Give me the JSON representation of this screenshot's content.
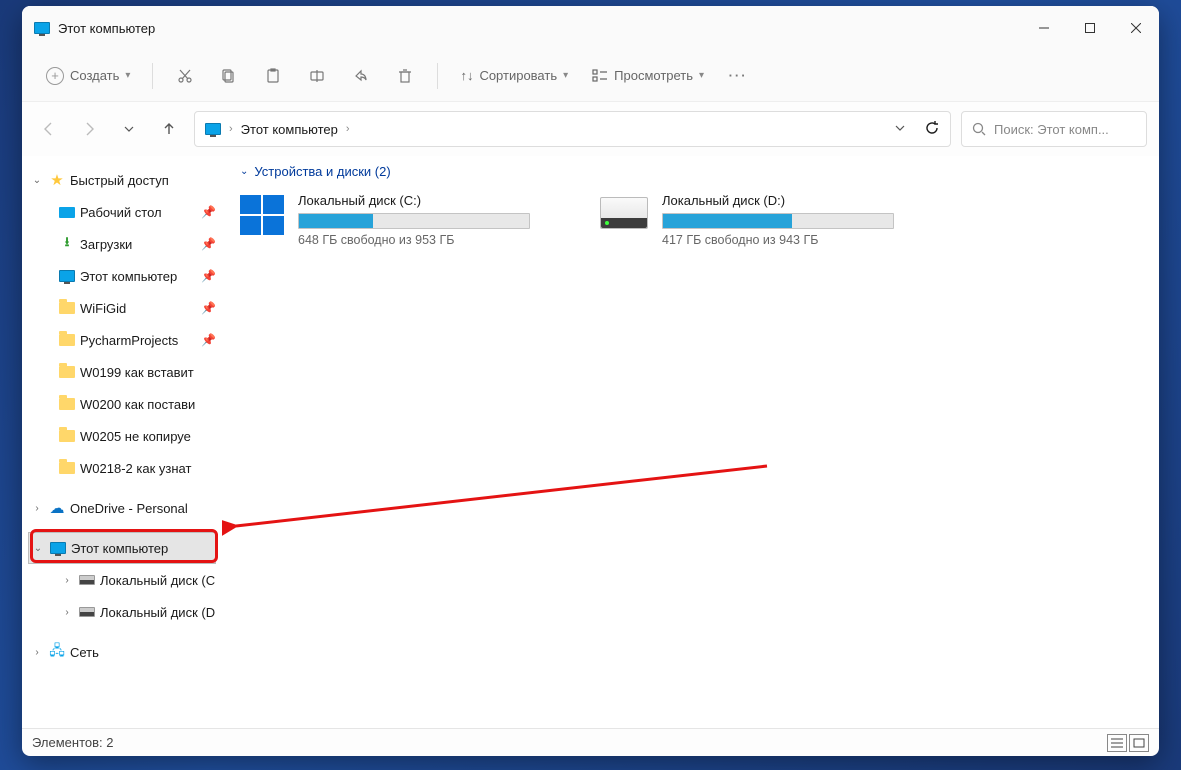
{
  "window": {
    "title": "Этот компьютер"
  },
  "toolbar": {
    "new_label": "Создать",
    "sort_label": "Сортировать",
    "view_label": "Просмотреть"
  },
  "breadcrumb": {
    "root": "Этот компьютер"
  },
  "search": {
    "placeholder": "Поиск: Этот комп..."
  },
  "sidebar": {
    "quick_access": "Быстрый доступ",
    "items": [
      {
        "label": "Рабочий стол",
        "pinned": true
      },
      {
        "label": "Загрузки",
        "pinned": true
      },
      {
        "label": "Этот компьютер",
        "pinned": true
      },
      {
        "label": "WiFiGid",
        "pinned": true
      },
      {
        "label": "PycharmProjects",
        "pinned": true
      },
      {
        "label": "W0199 как вставит",
        "pinned": false
      },
      {
        "label": "W0200 как постави",
        "pinned": false
      },
      {
        "label": "W0205 не копируе",
        "pinned": false
      },
      {
        "label": "W0218-2 как узнат",
        "pinned": false
      }
    ],
    "onedrive": "OneDrive - Personal",
    "this_pc": "Этот компьютер",
    "drives": [
      {
        "label": "Локальный диск (C"
      },
      {
        "label": "Локальный диск (D"
      }
    ],
    "network": "Сеть"
  },
  "content": {
    "group_label": "Устройства и диски (2)",
    "drives": [
      {
        "name": "Локальный диск (C:)",
        "free_text": "648 ГБ свободно из 953 ГБ",
        "fill_pct": 32
      },
      {
        "name": "Локальный диск (D:)",
        "free_text": "417 ГБ свободно из 943 ГБ",
        "fill_pct": 56
      }
    ]
  },
  "status": {
    "elements": "Элементов: 2"
  }
}
